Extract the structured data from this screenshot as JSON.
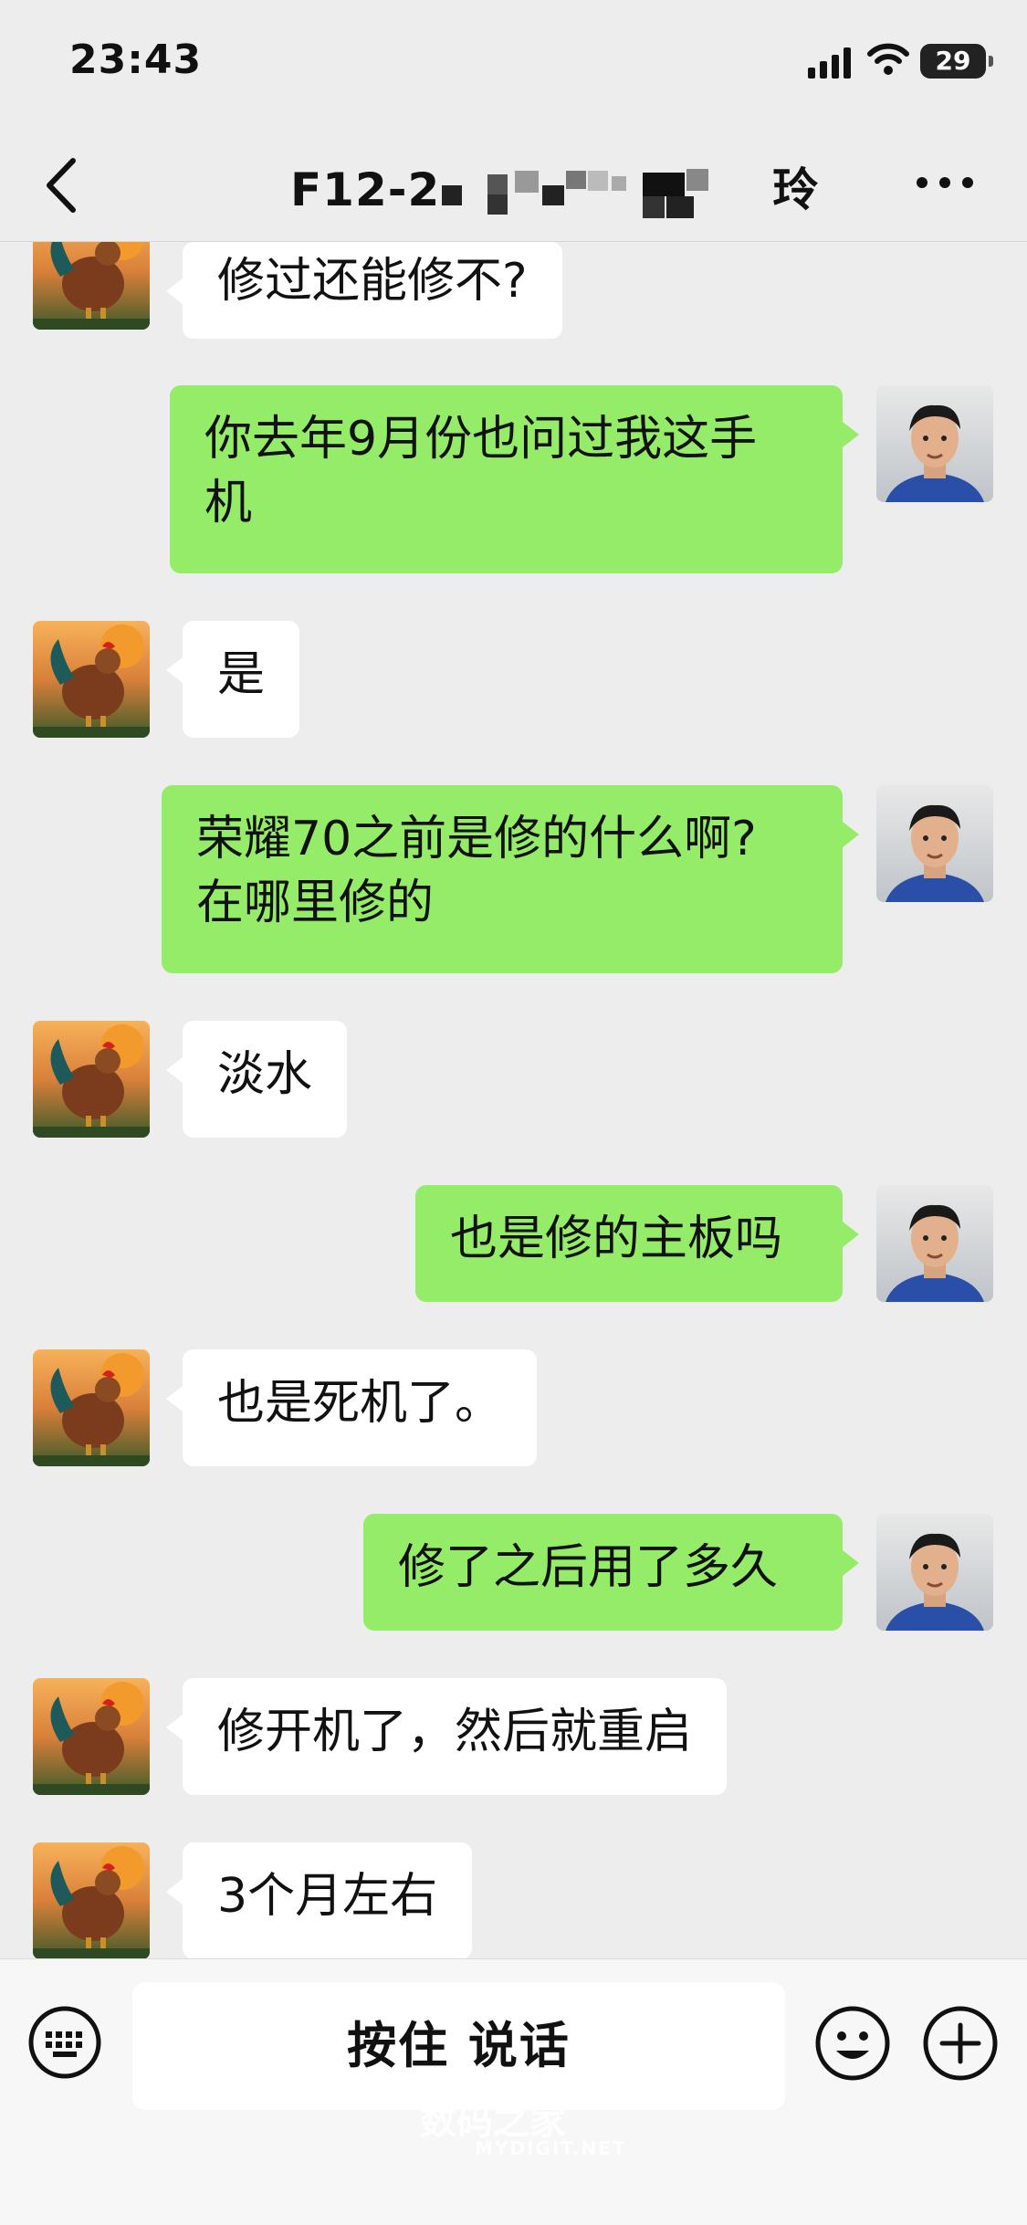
{
  "status_bar": {
    "time": "23:43",
    "battery": "29"
  },
  "nav": {
    "title_prefix": "F12-2",
    "title_suffix": "玲"
  },
  "messages": [
    {
      "side": "in",
      "lines": [
        "修过还能修不?"
      ]
    },
    {
      "side": "out",
      "lines": [
        "你去年9月份也问过我这手",
        "机"
      ]
    },
    {
      "side": "in",
      "lines": [
        "是"
      ]
    },
    {
      "side": "out",
      "lines": [
        "荣耀70之前是修的什么啊?",
        "在哪里修的"
      ]
    },
    {
      "side": "in",
      "lines": [
        "淡水"
      ]
    },
    {
      "side": "out",
      "lines": [
        "也是修的主板吗"
      ]
    },
    {
      "side": "in",
      "lines": [
        "也是死机了。"
      ]
    },
    {
      "side": "out",
      "lines": [
        "修了之后用了多久"
      ]
    },
    {
      "side": "in",
      "lines": [
        "修开机了，然后就重启"
      ]
    },
    {
      "side": "in",
      "lines": [
        "3个月左右"
      ]
    }
  ],
  "input": {
    "hold_to_talk": "按住 说话"
  },
  "watermark": {
    "cn": "数码之家",
    "en": "MYDIGIT.NET"
  },
  "colors": {
    "outgoing_bubble": "#95ec69",
    "incoming_bubble": "#ffffff",
    "background": "#ededed"
  }
}
